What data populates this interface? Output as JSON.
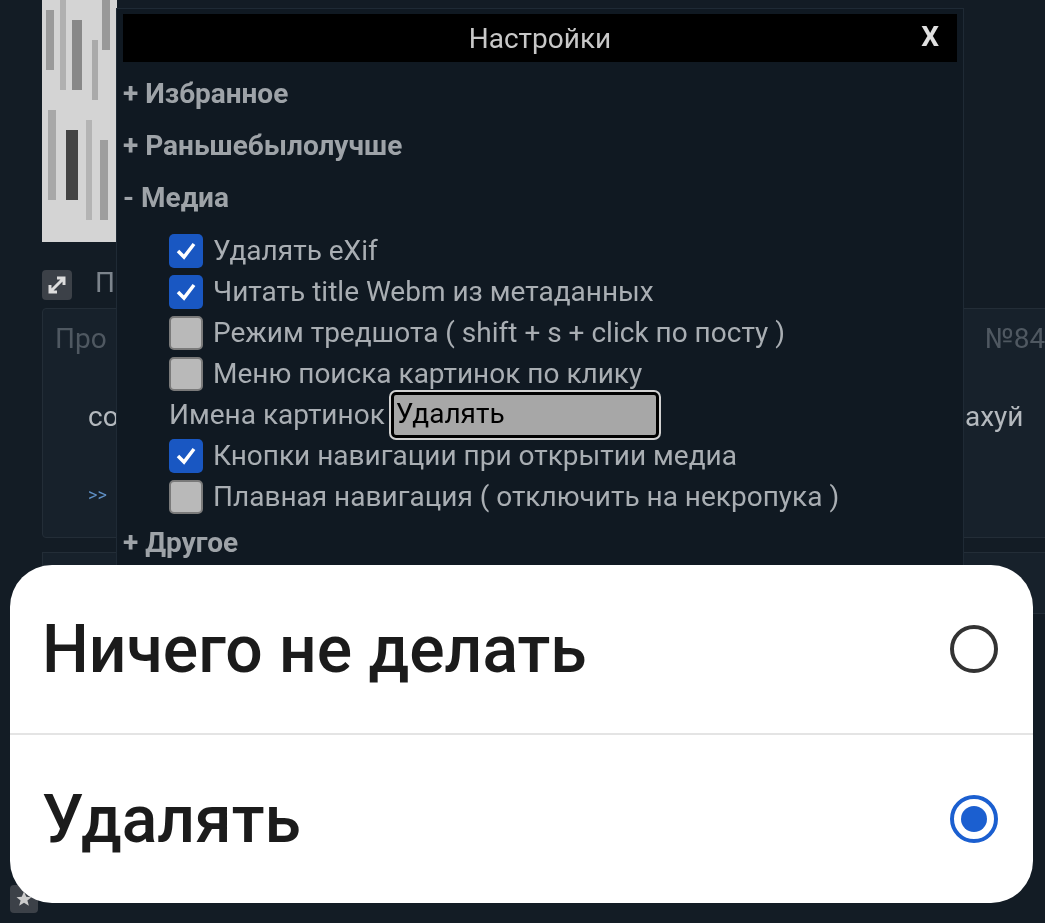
{
  "background": {
    "post": {
      "title_fragment": "П",
      "header_left": "Про",
      "header_right": "№84",
      "body_left": "со",
      "body_right": "ахуй",
      "link": ">>"
    }
  },
  "settings": {
    "title": "Настройки",
    "close": "X",
    "sections": [
      {
        "label": "+ Избранное"
      },
      {
        "label": "+ Раньшебылолучше"
      },
      {
        "label": "- Медиа",
        "items": [
          {
            "kind": "checkbox",
            "label": "Удалять eXif",
            "checked": true
          },
          {
            "kind": "checkbox",
            "label": "Читать title Webm из метаданных",
            "checked": true
          },
          {
            "kind": "checkbox",
            "label": "Режим тредшота ( shift + s + click по посту )",
            "checked": false
          },
          {
            "kind": "checkbox",
            "label": "Меню поиска картинок по клику",
            "checked": false
          },
          {
            "kind": "select",
            "label": "Имена картинок",
            "value": "Удалять"
          },
          {
            "kind": "checkbox",
            "label": "Кнопки навигации при открытии медиа",
            "checked": true
          },
          {
            "kind": "checkbox",
            "label": "Плавная навигация ( отключить на некропука )",
            "checked": false
          }
        ]
      },
      {
        "label": "+ Другое"
      }
    ]
  },
  "dialog": {
    "options": [
      {
        "label": "Ничего не делать",
        "selected": false
      },
      {
        "label": "Удалять",
        "selected": true
      }
    ]
  }
}
